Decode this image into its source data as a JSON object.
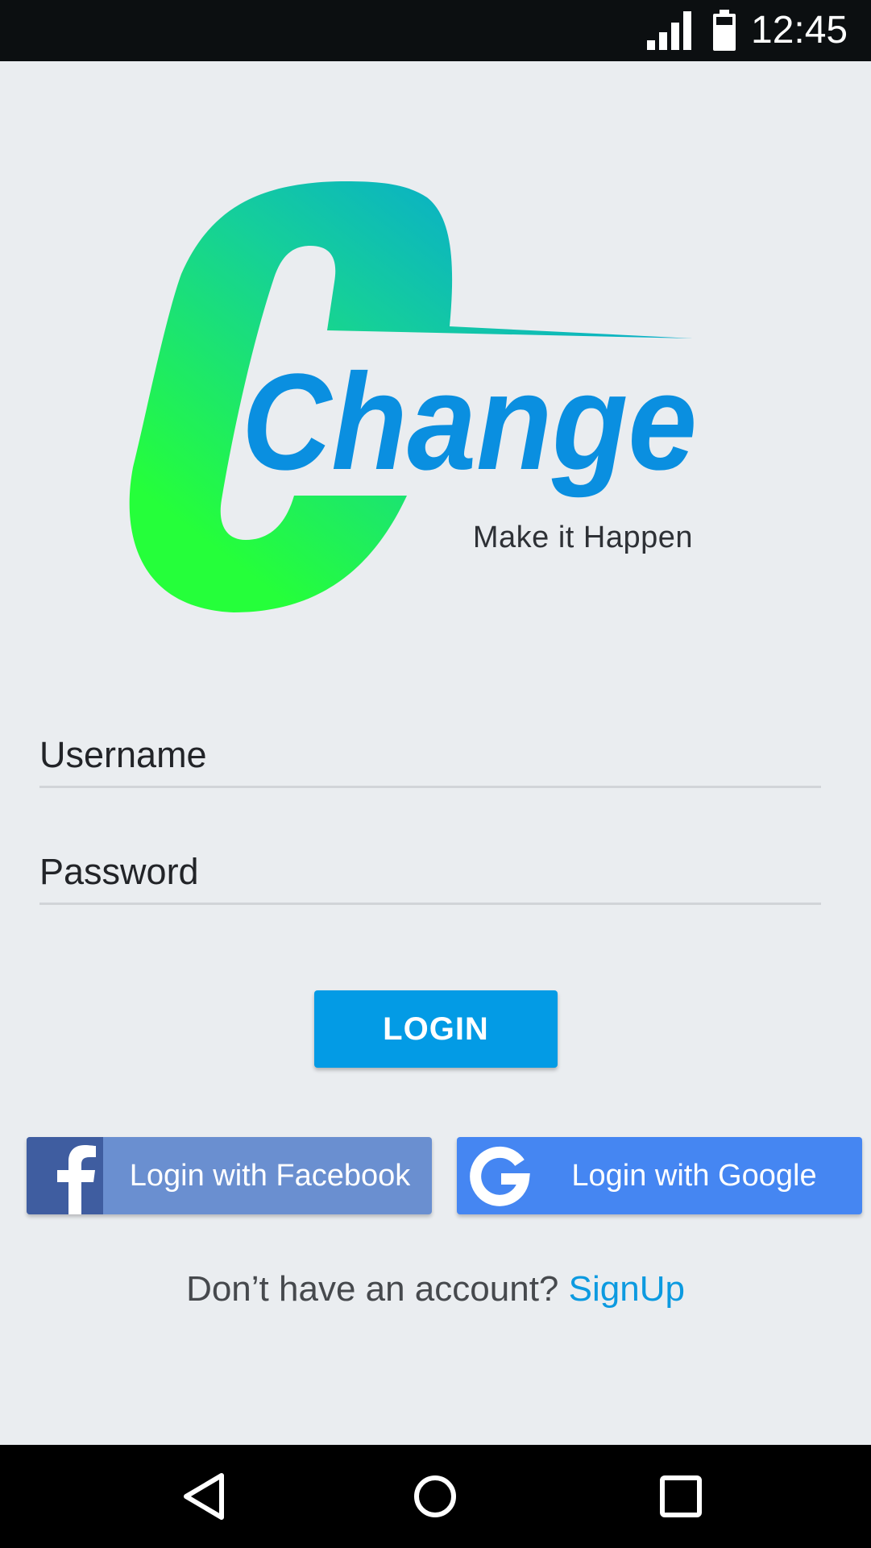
{
  "status_bar": {
    "time": "12:45",
    "signal_icon": "cell-signal-icon",
    "battery_icon": "battery-icon"
  },
  "logo": {
    "brand_text": "Change",
    "tagline": "Make it Happen",
    "colors": {
      "gradient_green": "#25ff3a",
      "gradient_blue": "#039be5",
      "text_blue": "#0a8fe0"
    }
  },
  "form": {
    "username": {
      "placeholder": "Username",
      "value": ""
    },
    "password": {
      "placeholder": "Password",
      "value": ""
    },
    "login_label": "LOGIN"
  },
  "social": {
    "facebook_label": "Login with Facebook",
    "facebook_icon": "facebook-icon",
    "google_label": "Login with Google",
    "google_icon": "google-icon"
  },
  "signup": {
    "prompt": "Don’t have an account?",
    "link": "SignUp"
  },
  "nav": {
    "back_icon": "back-triangle-icon",
    "home_icon": "home-circle-icon",
    "recent_icon": "recents-square-icon"
  },
  "colors": {
    "background": "#eaedf0",
    "accent": "#039be5",
    "facebook_bg": "#6a8fd0",
    "facebook_icon_bg": "#3f5da0",
    "google_bg": "#4586f2"
  }
}
